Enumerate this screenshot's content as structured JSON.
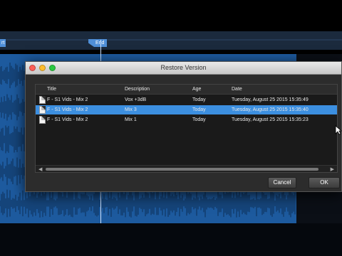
{
  "timeline": {
    "start_marker": "rt",
    "end_marker": "End"
  },
  "dialog": {
    "title": "Restore Version",
    "columns": [
      "Title",
      "Description",
      "Age",
      "Date"
    ],
    "rows": [
      {
        "title": "F - S1 Vids - Mix 2",
        "description": "Vox +3dB",
        "age": "Today",
        "date": "Tuesday, August 25 2015 15:35:49",
        "selected": false
      },
      {
        "title": "F - S1 Vids - Mix 2",
        "description": "Mix 3",
        "age": "Today",
        "date": "Tuesday, August 25 2015 15:35:40",
        "selected": true
      },
      {
        "title": "F - S1 Vids - Mix 2",
        "description": "Mix 1",
        "age": "Today",
        "date": "Tuesday, August 25 2015 15:35:23",
        "selected": false
      }
    ],
    "cancel_label": "Cancel",
    "ok_label": "OK"
  },
  "colors": {
    "selection": "#3c8fe0",
    "waveform": "#1d5a9e",
    "marker": "#4f8fd8"
  }
}
